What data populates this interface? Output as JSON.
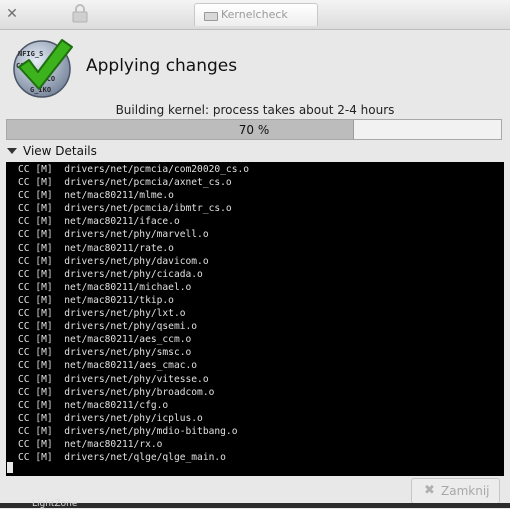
{
  "window": {
    "title": "Kernelcheck",
    "icons": {
      "close": "close-icon",
      "lock": "lock-icon",
      "app": "window-icon"
    }
  },
  "header": {
    "heading": "Applying changes",
    "logo_icon": "checkmark-logo",
    "logo_lines": [
      "NFIG_S",
      "CONF",
      "MLKCO",
      "G_IKO"
    ]
  },
  "status": {
    "text": "Building kernel: process takes about 2-4 hours"
  },
  "progress": {
    "value": 0.7,
    "label": "70 %"
  },
  "details": {
    "label": "View Details",
    "expanded": true,
    "arrow_icon": "triangle-down-icon"
  },
  "terminal": {
    "lines": [
      "CC [M]  drivers/net/pcmcia/com20020_cs.o",
      "CC [M]  drivers/net/pcmcia/axnet_cs.o",
      "CC [M]  net/mac80211/mlme.o",
      "CC [M]  drivers/net/pcmcia/ibmtr_cs.o",
      "CC [M]  net/mac80211/iface.o",
      "CC [M]  drivers/net/phy/marvell.o",
      "CC [M]  net/mac80211/rate.o",
      "CC [M]  drivers/net/phy/davicom.o",
      "CC [M]  drivers/net/phy/cicada.o",
      "CC [M]  net/mac80211/michael.o",
      "CC [M]  net/mac80211/tkip.o",
      "CC [M]  drivers/net/phy/lxt.o",
      "CC [M]  drivers/net/phy/qsemi.o",
      "CC [M]  net/mac80211/aes_ccm.o",
      "CC [M]  drivers/net/phy/smsc.o",
      "CC [M]  net/mac80211/aes_cmac.o",
      "CC [M]  drivers/net/phy/vitesse.o",
      "CC [M]  drivers/net/phy/broadcom.o",
      "CC [M]  net/mac80211/cfg.o",
      "CC [M]  drivers/net/phy/icplus.o",
      "CC [M]  drivers/net/phy/mdio-bitbang.o",
      "CC [M]  net/mac80211/rx.o",
      "CC [M]  drivers/net/qlge/qlge_main.o"
    ]
  },
  "buttons": {
    "close_label": "Zamknij",
    "close_icon": "close-x-icon",
    "close_enabled": false
  },
  "background": {
    "partial_text": "LightZone"
  },
  "colors": {
    "terminal_bg": "#000000",
    "terminal_fg": "#e0e0e0",
    "check_green": "#3cb31c"
  }
}
